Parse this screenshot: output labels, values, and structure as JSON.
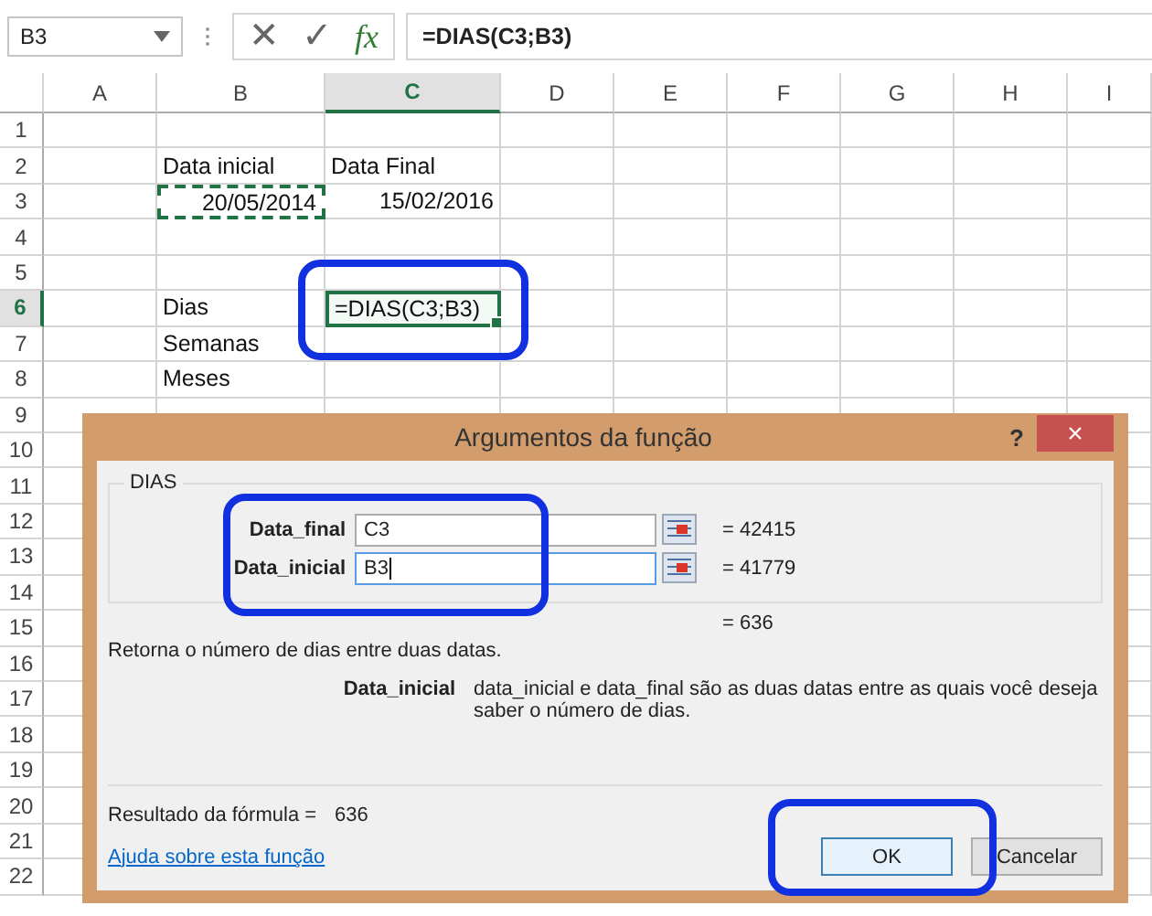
{
  "formula_bar": {
    "name_box": "B3",
    "cancel": "✕",
    "enter": "✓",
    "fx": "fx",
    "formula": "=DIAS(C3;B3)"
  },
  "sheet": {
    "columns": [
      {
        "label": "A",
        "selected": false
      },
      {
        "label": "B",
        "selected": false
      },
      {
        "label": "C",
        "selected": true
      },
      {
        "label": "D",
        "selected": false
      },
      {
        "label": "E",
        "selected": false
      },
      {
        "label": "F",
        "selected": false
      },
      {
        "label": "G",
        "selected": false
      },
      {
        "label": "H",
        "selected": false
      },
      {
        "label": "I",
        "selected": false
      }
    ],
    "rows": [
      {
        "label": "1",
        "selected": false
      },
      {
        "label": "2",
        "selected": false,
        "cells": {
          "B": {
            "text": "Data inicial",
            "kind": "text",
            "selected": false,
            "marquee": false
          },
          "C": {
            "text": "Data Final",
            "kind": "text",
            "selected": false,
            "marquee": false
          }
        }
      },
      {
        "label": "3",
        "selected": false,
        "cells": {
          "B": {
            "text": "20/05/2014",
            "kind": "number",
            "selected": false,
            "marquee": true
          },
          "C": {
            "text": "15/02/2016",
            "kind": "number",
            "selected": false,
            "marquee": false
          }
        }
      },
      {
        "label": "4",
        "selected": false
      },
      {
        "label": "5",
        "selected": false
      },
      {
        "label": "6",
        "selected": true,
        "cells": {
          "B": {
            "text": "Dias",
            "kind": "text",
            "selected": false,
            "marquee": false
          },
          "C": {
            "text": "=DIAS(C3;B3)",
            "kind": "text",
            "selected": true,
            "marquee": false
          }
        }
      },
      {
        "label": "7",
        "selected": false,
        "cells": {
          "B": {
            "text": "Semanas",
            "kind": "text",
            "selected": false,
            "marquee": false
          }
        }
      },
      {
        "label": "8",
        "selected": false,
        "cells": {
          "B": {
            "text": "Meses",
            "kind": "text",
            "selected": false,
            "marquee": false
          }
        }
      },
      {
        "label": "9",
        "selected": false
      },
      {
        "label": "10",
        "selected": false
      },
      {
        "label": "11",
        "selected": false
      },
      {
        "label": "12",
        "selected": false
      },
      {
        "label": "13",
        "selected": false
      },
      {
        "label": "14",
        "selected": false
      },
      {
        "label": "15",
        "selected": false
      },
      {
        "label": "16",
        "selected": false
      },
      {
        "label": "17",
        "selected": false
      },
      {
        "label": "18",
        "selected": false
      },
      {
        "label": "19",
        "selected": false
      },
      {
        "label": "20",
        "selected": false
      },
      {
        "label": "21",
        "selected": false
      },
      {
        "label": "22",
        "selected": false
      }
    ]
  },
  "dialog": {
    "title": "Argumentos da função",
    "help": "?",
    "close": "×",
    "function_name": "DIAS",
    "arguments": [
      {
        "label": "Data_final",
        "value": "C3",
        "focused": false,
        "result": "=  42415"
      },
      {
        "label": "Data_inicial",
        "value": "B3",
        "focused": true,
        "result": "=  41779"
      }
    ],
    "total": "=  636",
    "description": "Retorna o número de dias entre duas datas.",
    "argument_help": {
      "name": "Data_inicial",
      "text": "data_inicial e data_final são as duas datas entre as quais você deseja saber o número de dias."
    },
    "result_label": "Resultado da fórmula =",
    "result_value": "636",
    "help_link": "Ajuda sobre esta função",
    "buttons": [
      {
        "label": "OK",
        "default": true
      },
      {
        "label": "Cancelar",
        "default": false
      }
    ]
  }
}
